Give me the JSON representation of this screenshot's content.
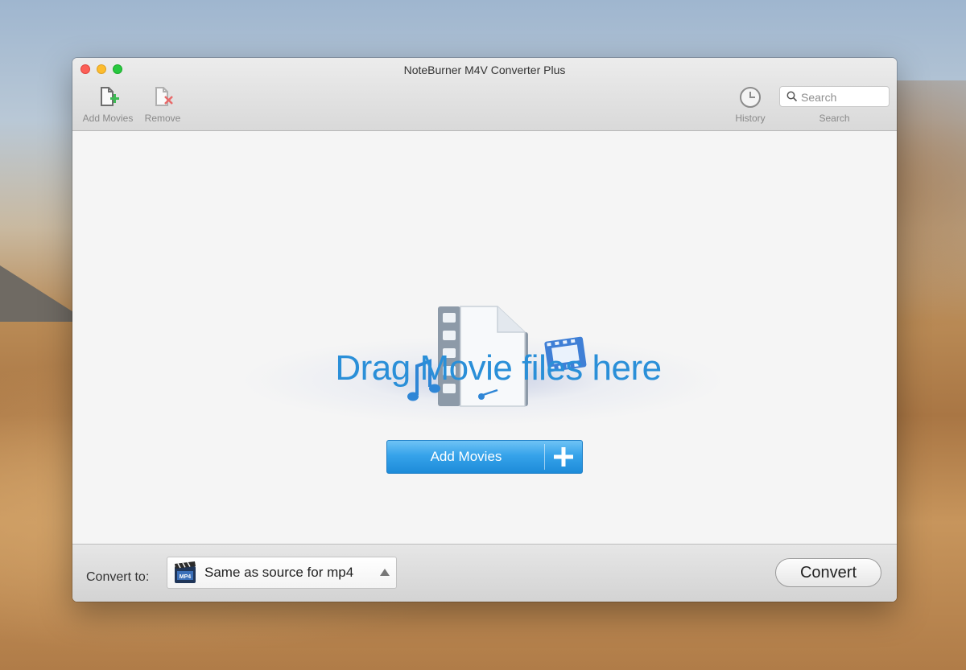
{
  "window": {
    "title": "NoteBurner M4V Converter Plus"
  },
  "toolbar": {
    "add_movies_label": "Add Movies",
    "remove_label": "Remove",
    "history_label": "History",
    "search_label": "Search",
    "search_placeholder": "Search",
    "search_value": ""
  },
  "main": {
    "drop_text": "Drag Movie files here",
    "add_button_label": "Add Movies"
  },
  "bottom": {
    "convert_to_label": "Convert to:",
    "format_value": "Same as source for mp4",
    "format_icon_text": "MP4",
    "convert_button": "Convert"
  },
  "colors": {
    "accent_blue": "#2a8fd8",
    "button_blue": "#36a3ea",
    "add_icon_green": "#3dbb54",
    "remove_icon_red": "#e86a6a"
  },
  "icons": {
    "add": "add-file-icon",
    "remove": "remove-file-icon",
    "history": "clock-icon",
    "search": "magnifier-icon",
    "hero": "film-document-icon"
  }
}
